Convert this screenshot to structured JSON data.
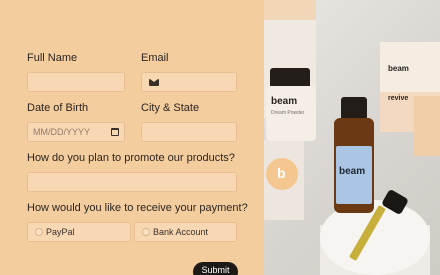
{
  "form": {
    "full_name_label": "Full Name",
    "email_label": "Email",
    "dob_label": "Date of Birth",
    "dob_placeholder": "MM/DD/YYYY",
    "city_state_label": "City & State",
    "promote_label": "How do you plan to promote our products?",
    "payment_label": "How would you like to receive your payment?",
    "payment_options": [
      "PayPal",
      "Bank Account"
    ],
    "submit_label": "Submit"
  },
  "photo": {
    "jar_brand": "beam",
    "jar_sub": "Dream Powder",
    "box_brand": "beam",
    "box_product": "revive",
    "bottle_brand": "beam",
    "circle_letter": "b"
  },
  "colors": {
    "form_background": "#f4cd9f",
    "input_background": "#f8d8b3",
    "submit_background": "#1d1916"
  }
}
